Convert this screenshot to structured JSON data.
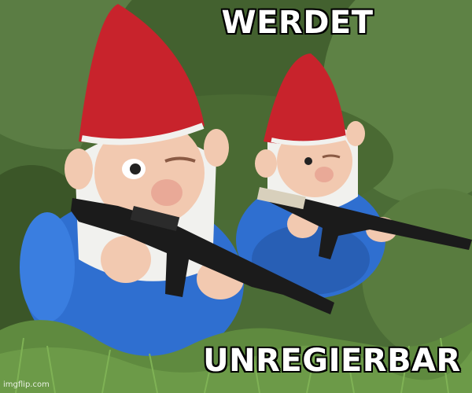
{
  "meme": {
    "top_text": "WERDET",
    "bottom_text": "UNREGIERBAR",
    "watermark": "imgflip.com"
  },
  "scene": {
    "subjects": [
      "garden-gnome-with-rifle-left",
      "garden-gnome-with-rifle-right"
    ],
    "colors": {
      "hat": "#c8232c",
      "coat": "#2f6fd0",
      "beard": "#f1f1ee",
      "skin": "#f2c9b0",
      "rifle": "#1b1b1b",
      "foliage": "#4d6f37"
    }
  }
}
